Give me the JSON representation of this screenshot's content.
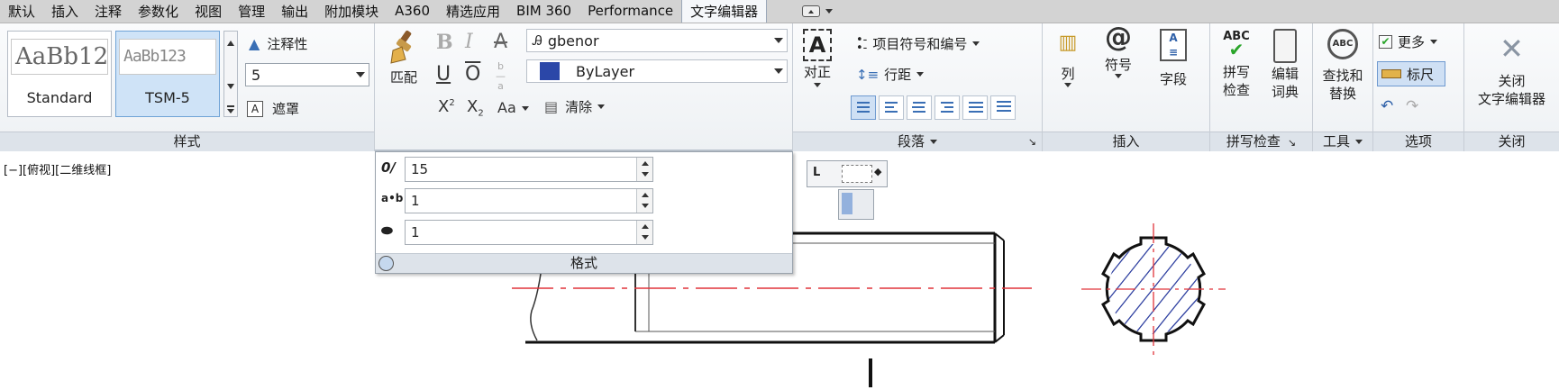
{
  "tabs": [
    "默认",
    "插入",
    "注释",
    "参数化",
    "视图",
    "管理",
    "输出",
    "附加模块",
    "A360",
    "精选应用",
    "BIM 360",
    "Performance",
    "文字编辑器"
  ],
  "active_tab": "文字编辑器",
  "style_panel": {
    "title": "样式",
    "swatch1_preview": "AaBb12",
    "swatch1_name": "Standard",
    "swatch2_preview": "AaBb123",
    "swatch2_name": "TSM-5",
    "annotative_label": "注释性",
    "height_value": "5",
    "mask_label": "遮罩"
  },
  "format_panel": {
    "match_label": "匹配",
    "font_value": "gbenor",
    "color_value": "ByLayer",
    "clear_label": "清除",
    "color_swatch": "#2b47a8"
  },
  "format_popup": {
    "title": "格式",
    "oblique_value": "15",
    "tracking_value": "1",
    "width_value": "1"
  },
  "paragraph_panel": {
    "title": "段落",
    "justify_label": "对正",
    "bullets_label": "项目符号和编号",
    "spacing_label": "行距"
  },
  "insert_panel": {
    "title": "插入",
    "columns_label": "列",
    "symbol_label": "符号",
    "field_label": "字段"
  },
  "spell_panel": {
    "title": "拼写检查",
    "spell_l1": "拼写",
    "spell_l2": "检查",
    "dict_l1": "编辑",
    "dict_l2": "词典"
  },
  "tools_panel": {
    "title": "工具",
    "find_l1": "查找和",
    "find_l2": "替换"
  },
  "options_panel": {
    "title": "选项",
    "more_label": "更多",
    "ruler_label": "标尺"
  },
  "close_panel": {
    "title": "关闭",
    "close_l1": "关闭",
    "close_l2": "文字编辑器"
  },
  "viewport_label": "[−][俯视][二维线框]",
  "colors": {
    "centerline": "#e0343a",
    "hatch": "#2d3fa0",
    "accent": "#3a6fb5"
  }
}
